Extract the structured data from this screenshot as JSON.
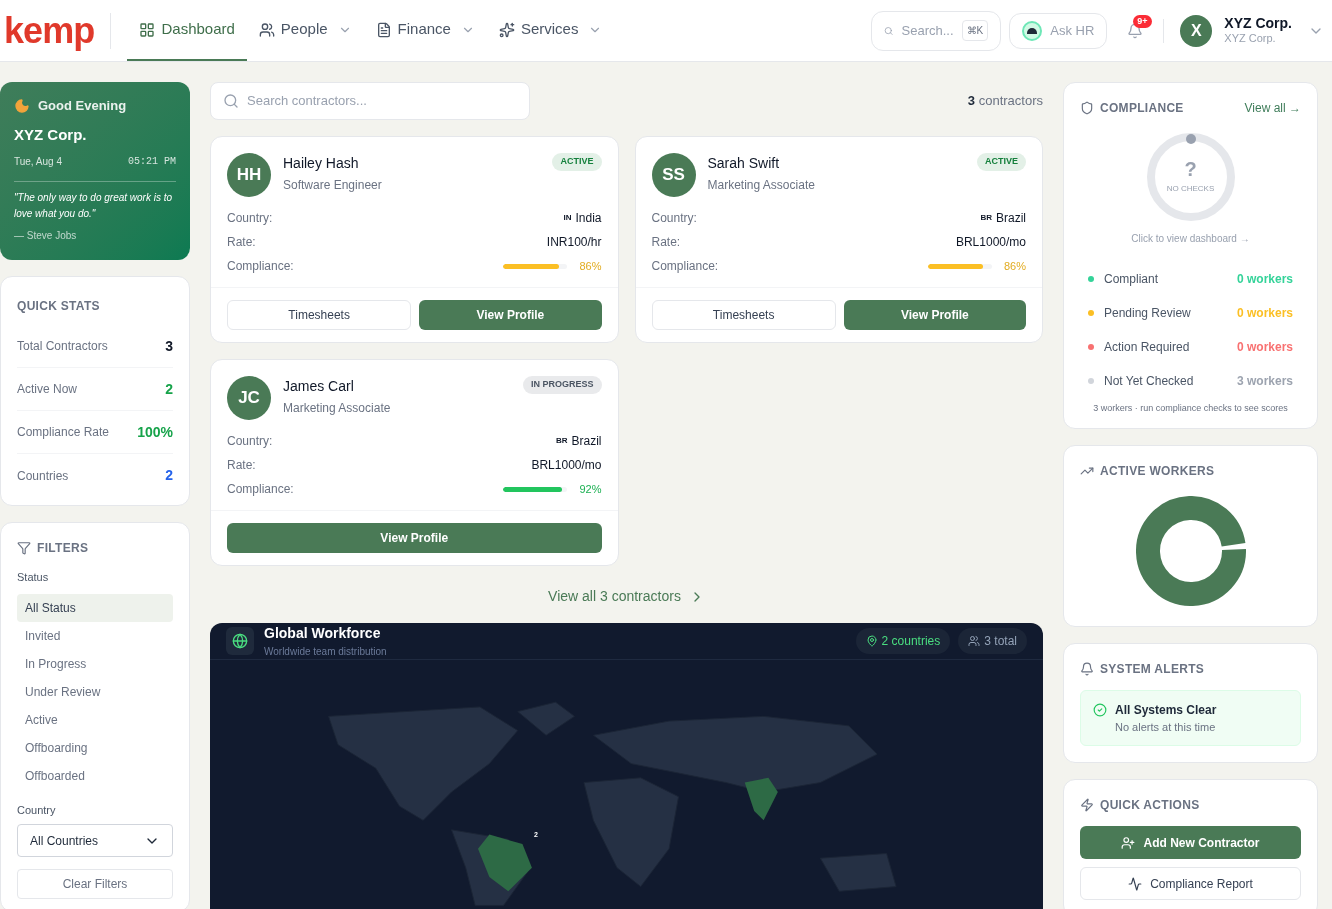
{
  "logo": "kemp",
  "nav": [
    {
      "label": "Dashboard",
      "selected": true,
      "dropdown": false
    },
    {
      "label": "People",
      "selected": false,
      "dropdown": true
    },
    {
      "label": "Finance",
      "selected": false,
      "dropdown": true
    },
    {
      "label": "Services",
      "selected": false,
      "dropdown": true
    }
  ],
  "search": {
    "placeholder": "Search...",
    "shortcut": "⌘K"
  },
  "ask_hr": "Ask HR",
  "notifications": {
    "badge": "9+"
  },
  "account": {
    "initial": "X",
    "name": "XYZ Corp.",
    "subtitle": "XYZ Corp."
  },
  "greeting": {
    "title": "Good Evening",
    "company": "XYZ Corp.",
    "date": "Tue, Aug 4",
    "time": "05:21 PM",
    "quote": "\"The only way to do great work is to love what you do.\"",
    "author": "— Steve Jobs"
  },
  "quick_stats": {
    "title": "QUICK STATS",
    "items": [
      {
        "label": "Total Contractors",
        "value": "3",
        "color": "#111827"
      },
      {
        "label": "Active Now",
        "value": "2",
        "color": "#16a34a"
      },
      {
        "label": "Compliance Rate",
        "value": "100%",
        "color": "#16a34a"
      },
      {
        "label": "Countries",
        "value": "2",
        "color": "#2563eb"
      }
    ]
  },
  "filters": {
    "title": "FILTERS",
    "status_label": "Status",
    "statuses": [
      {
        "label": "All Status",
        "selected": true
      },
      {
        "label": "Invited",
        "selected": false
      },
      {
        "label": "In Progress",
        "selected": false
      },
      {
        "label": "Under Review",
        "selected": false
      },
      {
        "label": "Active",
        "selected": false
      },
      {
        "label": "Offboarding",
        "selected": false
      },
      {
        "label": "Offboarded",
        "selected": false
      }
    ],
    "country_label": "Country",
    "country_value": "All Countries",
    "clear": "Clear Filters"
  },
  "contractor_search": {
    "placeholder": "Search contractors..."
  },
  "contractor_count": {
    "count": "3",
    "label": "contractors"
  },
  "contractors": [
    {
      "initials": "HH",
      "name": "Hailey Hash",
      "role": "Software Engineer",
      "status": {
        "label": "ACTIVE",
        "color": "#15803d"
      },
      "country_label": "Country:",
      "country_code": "IN",
      "country": "India",
      "rate_label": "Rate:",
      "rate": "INR100/hr",
      "compliance_label": "Compliance:",
      "compliance": {
        "level": 0.86,
        "value": "86%",
        "color": "#fbbf24"
      },
      "buttons": [
        {
          "label": "Timesheets",
          "kind": "secondary"
        },
        {
          "label": "View Profile",
          "kind": "primary"
        }
      ]
    },
    {
      "initials": "SS",
      "name": "Sarah Swift",
      "role": "Marketing Associate",
      "status": {
        "label": "ACTIVE",
        "color": "#15803d"
      },
      "country_label": "Country:",
      "country_code": "BR",
      "country": "Brazil",
      "rate_label": "Rate:",
      "rate": "BRL1000/mo",
      "compliance_label": "Compliance:",
      "compliance": {
        "level": 0.86,
        "value": "86%",
        "color": "#fbbf24"
      },
      "buttons": [
        {
          "label": "Timesheets",
          "kind": "secondary"
        },
        {
          "label": "View Profile",
          "kind": "primary"
        }
      ]
    },
    {
      "initials": "JC",
      "name": "James Carl",
      "role": "Marketing Associate",
      "status": {
        "label": "IN PROGRESS",
        "color": "#4b5563"
      },
      "country_label": "Country:",
      "country_code": "BR",
      "country": "Brazil",
      "rate_label": "Rate:",
      "rate": "BRL1000/mo",
      "compliance_label": "Compliance:",
      "compliance": {
        "level": 0.92,
        "value": "92%",
        "color": "#22c55e"
      },
      "buttons": [
        {
          "label": "View Profile",
          "kind": "primary"
        }
      ]
    }
  ],
  "view_all": "View all 3 contractors",
  "workforce": {
    "title": "Global Workforce",
    "subtitle": "Worldwide team distribution",
    "countries": "2 countries",
    "total": "3 total",
    "marker": "2"
  },
  "compliance": {
    "title": "COMPLIANCE",
    "view_all": "View all →",
    "ring_symbol": "?",
    "ring_label": "NO CHECKS",
    "hint": "Click to view dashboard →",
    "items": [
      {
        "label": "Compliant",
        "value": "0 workers",
        "color": "#34d399"
      },
      {
        "label": "Pending Review",
        "value": "0 workers",
        "color": "#fbbf24"
      },
      {
        "label": "Action Required",
        "value": "0 workers",
        "color": "#f87171"
      },
      {
        "label": "Not Yet Checked",
        "value": "3 workers",
        "color": "#d1d5db"
      }
    ],
    "footer": "3 workers · run compliance checks to see scores"
  },
  "active_workers": {
    "title": "ACTIVE WORKERS"
  },
  "alerts": {
    "title": "SYSTEM ALERTS",
    "status_title": "All Systems Clear",
    "status_text": "No alerts at this time"
  },
  "quick_actions": {
    "title": "QUICK ACTIONS",
    "buttons": [
      {
        "label": "Add New Contractor",
        "kind": "primary"
      },
      {
        "label": "Compliance Report",
        "kind": "secondary"
      }
    ]
  }
}
